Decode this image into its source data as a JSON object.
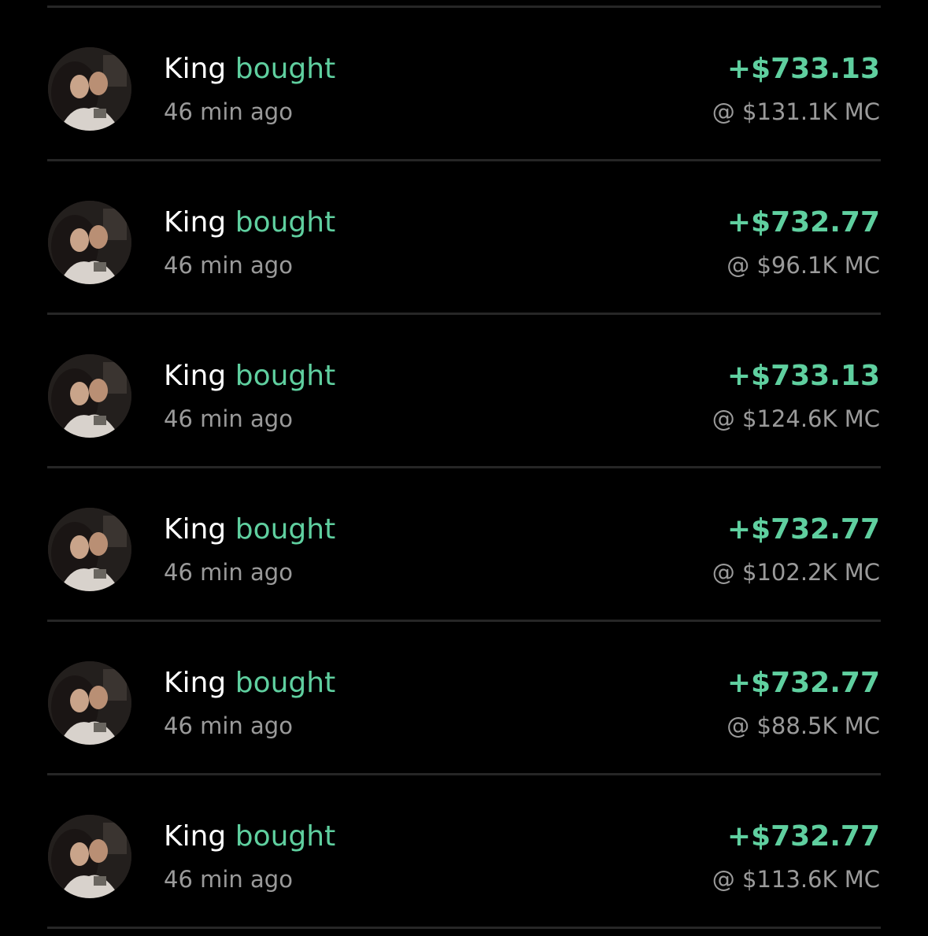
{
  "trades": [
    {
      "user": "King",
      "action": "bought",
      "time": "46 min ago",
      "amount": "+$733.13",
      "market_cap": "@ $131.1K MC"
    },
    {
      "user": "King",
      "action": "bought",
      "time": "46 min ago",
      "amount": "+$732.77",
      "market_cap": "@ $96.1K MC"
    },
    {
      "user": "King",
      "action": "bought",
      "time": "46 min ago",
      "amount": "+$733.13",
      "market_cap": "@ $124.6K MC"
    },
    {
      "user": "King",
      "action": "bought",
      "time": "46 min ago",
      "amount": "+$732.77",
      "market_cap": "@ $102.2K MC"
    },
    {
      "user": "King",
      "action": "bought",
      "time": "46 min ago",
      "amount": "+$732.77",
      "market_cap": "@ $88.5K MC"
    },
    {
      "user": "King",
      "action": "bought",
      "time": "46 min ago",
      "amount": "+$732.77",
      "market_cap": "@ $113.6K MC"
    }
  ],
  "colors": {
    "background": "#000000",
    "accent_green": "#5fcf9f",
    "secondary_text": "#9a9a9a",
    "divider": "#262626"
  }
}
